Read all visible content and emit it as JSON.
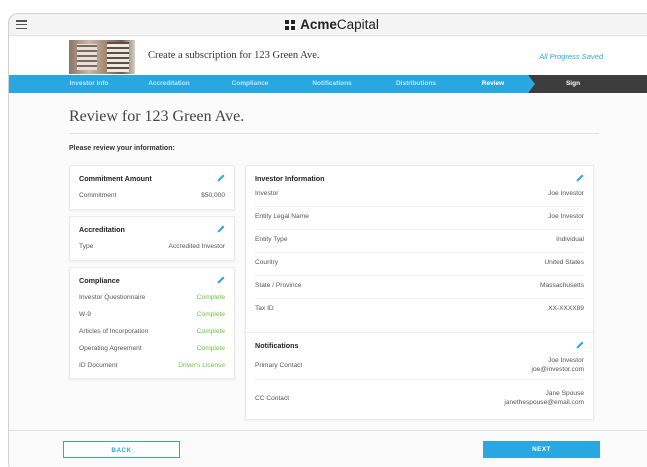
{
  "app": {
    "brand_bold": "Acme",
    "brand_rest": "Capital"
  },
  "header": {
    "subscription_title": "Create a subscription for 123 Green Ave.",
    "save_status": "All Progress Saved"
  },
  "steps": [
    {
      "label": "Investor Info",
      "active": false
    },
    {
      "label": "Accreditation",
      "active": false
    },
    {
      "label": "Compliance",
      "active": false
    },
    {
      "label": "Notifications",
      "active": false
    },
    {
      "label": "Distributions",
      "active": false
    },
    {
      "label": "Review",
      "active": true
    },
    {
      "label": "Sign",
      "active": false
    }
  ],
  "page": {
    "title": "Review for 123 Green Ave.",
    "prompt": "Please review your information:"
  },
  "commitment": {
    "title": "Commitment Amount",
    "rows": [
      {
        "key": "Commitment",
        "value": "$50,000"
      }
    ]
  },
  "accreditation": {
    "title": "Accreditation",
    "rows": [
      {
        "key": "Type",
        "value": "Accredited Investor"
      }
    ]
  },
  "compliance": {
    "title": "Compliance",
    "rows": [
      {
        "key": "Investor Questionnaire",
        "value": "Complete"
      },
      {
        "key": "W-9",
        "value": "Complete"
      },
      {
        "key": "Articles of Incorporation",
        "value": "Complete"
      },
      {
        "key": "Operating Agreement",
        "value": "Complete"
      },
      {
        "key": "ID Document",
        "value": "Driver's License"
      }
    ]
  },
  "investor": {
    "title": "Investor Information",
    "rows": [
      {
        "key": "Investor",
        "value": "Joe Investor"
      },
      {
        "key": "Entity Legal Name",
        "value": "Joe Investor"
      },
      {
        "key": "Entity Type",
        "value": "Individual"
      },
      {
        "key": "Country",
        "value": "United States"
      },
      {
        "key": "State / Province",
        "value": "Massachusetts"
      },
      {
        "key": "Tax ID",
        "value": "XX-XXXX89"
      }
    ]
  },
  "notifications": {
    "title": "Notifications",
    "rows": [
      {
        "key": "Primary Contact",
        "name": "Joe Investor",
        "email": "joe@investor.com"
      },
      {
        "key": "CC Contact",
        "name": "Jane Spouse",
        "email": "janethespouse@email.com"
      }
    ]
  },
  "footer": {
    "back_label": "BACK",
    "next_label": "NEXT"
  },
  "colors": {
    "accent": "#29a7e1",
    "complete": "#6cc04a",
    "sign_step": "#3d3d3d"
  },
  "icons": {
    "edit": "pencil-icon",
    "menu": "hamburger-icon",
    "logo": "acme-logo-icon"
  }
}
